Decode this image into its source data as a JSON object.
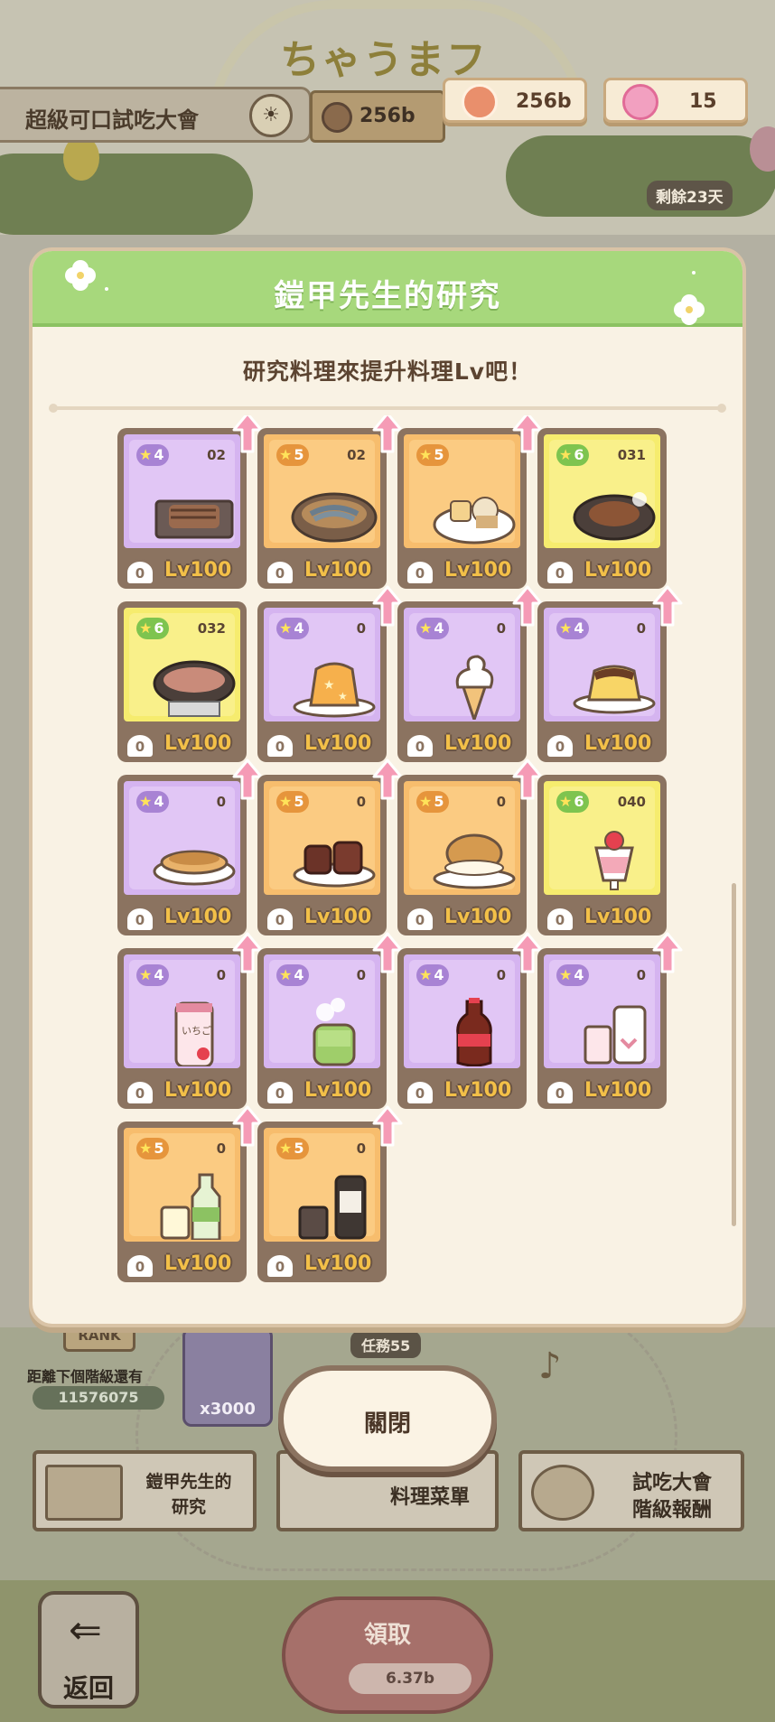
{
  "hud": {
    "event_name": "超級可口試吃大會",
    "sign_value": "256b",
    "currency_value": "256b",
    "candy_value": "15",
    "days_left": "剩餘23天",
    "arch_text": "ちゃうまフ"
  },
  "modal": {
    "title": "鎧甲先生的研究",
    "subtitle": "研究料理來提升料理Lv吧！",
    "close_label": "關閉"
  },
  "cards": [
    {
      "color": "lav",
      "stars": "4",
      "num": "",
      "food": "",
      "level": "Lv100",
      "chef": "0"
    },
    {
      "color": "lav",
      "stars": "4",
      "num": "",
      "food": "",
      "level": "Lv100",
      "chef": "0"
    },
    {
      "color": "lav",
      "stars": "4",
      "num": "",
      "food": "",
      "level": "Lv100",
      "chef": "0"
    },
    {
      "color": "lav",
      "stars": "4",
      "num": "",
      "food": "",
      "level": "Lv100",
      "chef": "0"
    },
    {
      "color": "lav",
      "stars": "4",
      "num": "02",
      "food": "grilled-fish",
      "level": "Lv100",
      "chef": "0",
      "arrow": true
    },
    {
      "color": "ora",
      "stars": "5",
      "num": "02",
      "food": "fish-pot",
      "level": "Lv100",
      "chef": "0",
      "arrow": true
    },
    {
      "color": "ora",
      "stars": "5",
      "num": "",
      "food": "oden",
      "level": "Lv100",
      "chef": "0",
      "arrow": true
    },
    {
      "color": "yel",
      "stars": "6",
      "num": "031",
      "food": "steak-plate",
      "level": "Lv100",
      "chef": "0",
      "arrow": false
    },
    {
      "color": "yel",
      "stars": "6",
      "num": "032",
      "food": "sukiyaki",
      "level": "Lv100",
      "chef": "0",
      "arrow": false
    },
    {
      "color": "lav",
      "stars": "4",
      "num": "0",
      "food": "jelly",
      "level": "Lv100",
      "chef": "0",
      "arrow": true
    },
    {
      "color": "lav",
      "stars": "4",
      "num": "0",
      "food": "soft-serve",
      "level": "Lv100",
      "chef": "0",
      "arrow": true
    },
    {
      "color": "lav",
      "stars": "4",
      "num": "0",
      "food": "pudding",
      "level": "Lv100",
      "chef": "0",
      "arrow": true
    },
    {
      "color": "lav",
      "stars": "4",
      "num": "0",
      "food": "pancake",
      "level": "Lv100",
      "chef": "0",
      "arrow": true
    },
    {
      "color": "ora",
      "stars": "5",
      "num": "0",
      "food": "canele",
      "level": "Lv100",
      "chef": "0",
      "arrow": true
    },
    {
      "color": "ora",
      "stars": "5",
      "num": "0",
      "food": "cream-puff",
      "level": "Lv100",
      "chef": "0",
      "arrow": true
    },
    {
      "color": "yel",
      "stars": "6",
      "num": "040",
      "food": "parfait",
      "level": "Lv100",
      "chef": "0",
      "arrow": false
    },
    {
      "color": "lav",
      "stars": "4",
      "num": "0",
      "food": "milk-can",
      "level": "Lv100",
      "chef": "0",
      "arrow": true
    },
    {
      "color": "lav",
      "stars": "4",
      "num": "0",
      "food": "green-tea",
      "level": "Lv100",
      "chef": "0",
      "arrow": true
    },
    {
      "color": "lav",
      "stars": "4",
      "num": "0",
      "food": "cola",
      "level": "Lv100",
      "chef": "0",
      "arrow": true
    },
    {
      "color": "lav",
      "stars": "4",
      "num": "0",
      "food": "drink-glass",
      "level": "Lv100",
      "chef": "0",
      "arrow": true
    },
    {
      "color": "ora",
      "stars": "5",
      "num": "0",
      "food": "soda-bottle",
      "level": "Lv100",
      "chef": "0",
      "arrow": true
    },
    {
      "color": "ora",
      "stars": "5",
      "num": "0",
      "food": "tea-bottle",
      "level": "Lv100",
      "chef": "0",
      "arrow": true
    }
  ],
  "bottom": {
    "rank_badge": "RANK",
    "rank_label": "距離下個階級還有",
    "rank_value": "11576075",
    "gem_value": "x3000",
    "mission_label": "任務55",
    "menu_research_1": "鎧甲先生的",
    "menu_research_2": "研究",
    "menu_recipe": "料理菜單",
    "menu_rank_1": "試吃大會",
    "menu_rank_2": "階級報酬",
    "back_label": "返回",
    "claim_label": "領取",
    "claim_value": "6.37b"
  },
  "colors": {
    "header_green": "#a7d87c",
    "lavender_card": "#e1c6f5",
    "orange_card": "#fbcb82",
    "yellow_card": "#f9f08a",
    "card_border": "#8b7360",
    "arrow_pink": "#f59bb6"
  }
}
